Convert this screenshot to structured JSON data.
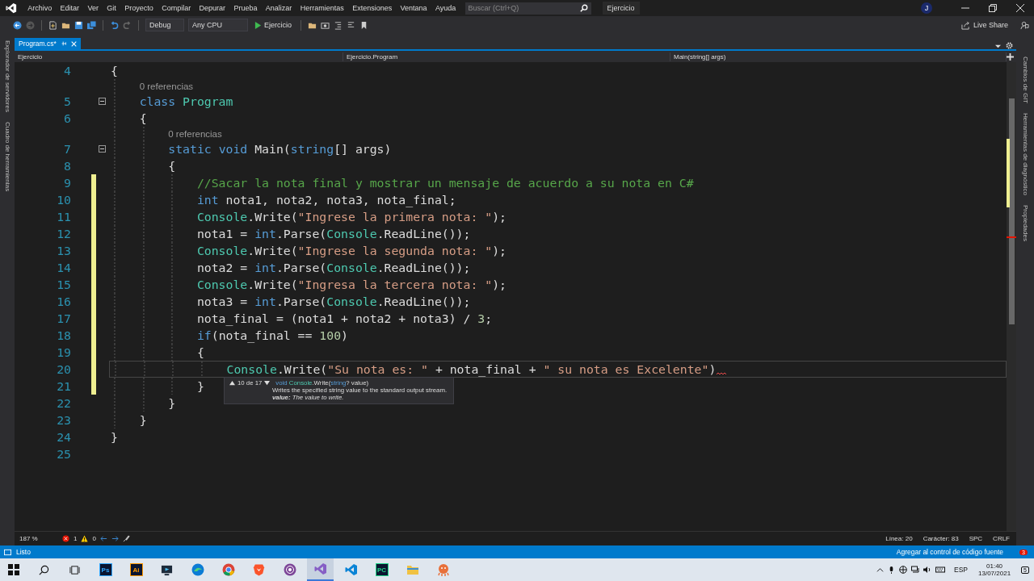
{
  "menu": [
    "Archivo",
    "Editar",
    "Ver",
    "Git",
    "Proyecto",
    "Compilar",
    "Depurar",
    "Prueba",
    "Analizar",
    "Herramientas",
    "Extensiones",
    "Ventana",
    "Ayuda"
  ],
  "search": {
    "placeholder": "Buscar (Ctrl+Q)"
  },
  "solution_name": "Ejercicio",
  "user_initial": "J",
  "toolbar": {
    "configuration": "Debug",
    "platform": "Any CPU",
    "start": "Ejercicio"
  },
  "live_share": "Live Share",
  "left_panels": [
    "Explorador de servidores",
    "Cuadro de herramientas"
  ],
  "right_panels": [
    "Cambios de GIT",
    "Herramientas de diagnóstico",
    "Propiedades"
  ],
  "document_tabs": [
    {
      "label": "Program.cs*",
      "selected": true
    }
  ],
  "nav_bar": {
    "project": "Ejercicio",
    "type": "Ejercicio.Program",
    "member": "Main(string[] args)"
  },
  "editor": {
    "lines": [
      {
        "kind": "code",
        "number": "4",
        "changed": false,
        "fold": false,
        "current": false,
        "error": false,
        "tokens": [
          {
            "kind": "plain",
            "text": "{"
          }
        ]
      },
      {
        "kind": "lens",
        "text": "    0 referencias"
      },
      {
        "kind": "code",
        "number": "5",
        "changed": false,
        "fold": true,
        "current": false,
        "error": false,
        "tokens": [
          {
            "kind": "kw",
            "text": "    class"
          },
          {
            "kind": "type",
            "text": " Program"
          }
        ]
      },
      {
        "kind": "code",
        "number": "6",
        "changed": false,
        "fold": false,
        "current": false,
        "error": false,
        "tokens": [
          {
            "kind": "plain",
            "text": "    {"
          }
        ]
      },
      {
        "kind": "lens",
        "text": "        0 referencias"
      },
      {
        "kind": "code",
        "number": "7",
        "changed": false,
        "fold": true,
        "current": false,
        "error": false,
        "tokens": [
          {
            "kind": "kw",
            "text": "        static"
          },
          {
            "kind": "kw",
            "text": " void"
          },
          {
            "kind": "plain",
            "text": " Main("
          },
          {
            "kind": "kw",
            "text": "string"
          },
          {
            "kind": "plain",
            "text": "[] args)"
          }
        ]
      },
      {
        "kind": "code",
        "number": "8",
        "changed": false,
        "fold": false,
        "current": false,
        "error": false,
        "tokens": [
          {
            "kind": "plain",
            "text": "        {"
          }
        ]
      },
      {
        "kind": "code",
        "number": "9",
        "changed": true,
        "fold": false,
        "current": false,
        "error": false,
        "tokens": [
          {
            "kind": "cmt",
            "text": "            //Sacar la nota final y mostrar un mensaje de acuerdo a su nota en C#"
          }
        ]
      },
      {
        "kind": "code",
        "number": "10",
        "changed": true,
        "fold": false,
        "current": false,
        "error": false,
        "tokens": [
          {
            "kind": "kw",
            "text": "            int"
          },
          {
            "kind": "plain",
            "text": " nota1, nota2, nota3, nota_final;"
          }
        ]
      },
      {
        "kind": "code",
        "number": "11",
        "changed": true,
        "fold": false,
        "current": false,
        "error": false,
        "tokens": [
          {
            "kind": "type",
            "text": "            Console"
          },
          {
            "kind": "plain",
            "text": ".Write("
          },
          {
            "kind": "str",
            "text": "\"Ingrese la primera nota: \""
          },
          {
            "kind": "plain",
            "text": ");"
          }
        ]
      },
      {
        "kind": "code",
        "number": "12",
        "changed": true,
        "fold": false,
        "current": false,
        "error": false,
        "tokens": [
          {
            "kind": "plain",
            "text": "            nota1 = "
          },
          {
            "kind": "kw",
            "text": "int"
          },
          {
            "kind": "plain",
            "text": ".Parse("
          },
          {
            "kind": "type",
            "text": "Console"
          },
          {
            "kind": "plain",
            "text": ".ReadLine());"
          }
        ]
      },
      {
        "kind": "code",
        "number": "13",
        "changed": true,
        "fold": false,
        "current": false,
        "error": false,
        "tokens": [
          {
            "kind": "type",
            "text": "            Console"
          },
          {
            "kind": "plain",
            "text": ".Write("
          },
          {
            "kind": "str",
            "text": "\"Ingrese la segunda nota: \""
          },
          {
            "kind": "plain",
            "text": ");"
          }
        ]
      },
      {
        "kind": "code",
        "number": "14",
        "changed": true,
        "fold": false,
        "current": false,
        "error": false,
        "tokens": [
          {
            "kind": "plain",
            "text": "            nota2 = "
          },
          {
            "kind": "kw",
            "text": "int"
          },
          {
            "kind": "plain",
            "text": ".Parse("
          },
          {
            "kind": "type",
            "text": "Console"
          },
          {
            "kind": "plain",
            "text": ".ReadLine());"
          }
        ]
      },
      {
        "kind": "code",
        "number": "15",
        "changed": true,
        "fold": false,
        "current": false,
        "error": false,
        "tokens": [
          {
            "kind": "type",
            "text": "            Console"
          },
          {
            "kind": "plain",
            "text": ".Write("
          },
          {
            "kind": "str",
            "text": "\"Ingresa la tercera nota: \""
          },
          {
            "kind": "plain",
            "text": ");"
          }
        ]
      },
      {
        "kind": "code",
        "number": "16",
        "changed": true,
        "fold": false,
        "current": false,
        "error": false,
        "tokens": [
          {
            "kind": "plain",
            "text": "            nota3 = "
          },
          {
            "kind": "kw",
            "text": "int"
          },
          {
            "kind": "plain",
            "text": ".Parse("
          },
          {
            "kind": "type",
            "text": "Console"
          },
          {
            "kind": "plain",
            "text": ".ReadLine());"
          }
        ]
      },
      {
        "kind": "code",
        "number": "17",
        "changed": true,
        "fold": false,
        "current": false,
        "error": false,
        "tokens": [
          {
            "kind": "plain",
            "text": "            nota_final = (nota1 + nota2 + nota3) / "
          },
          {
            "kind": "num",
            "text": "3"
          },
          {
            "kind": "plain",
            "text": ";"
          }
        ]
      },
      {
        "kind": "code",
        "number": "18",
        "changed": true,
        "fold": false,
        "current": false,
        "error": false,
        "tokens": [
          {
            "kind": "kw",
            "text": "            if"
          },
          {
            "kind": "plain",
            "text": "(nota_final == "
          },
          {
            "kind": "num",
            "text": "100"
          },
          {
            "kind": "plain",
            "text": ")"
          }
        ]
      },
      {
        "kind": "code",
        "number": "19",
        "changed": true,
        "fold": false,
        "current": false,
        "error": false,
        "tokens": [
          {
            "kind": "plain",
            "text": "            {"
          }
        ]
      },
      {
        "kind": "code",
        "number": "20",
        "changed": true,
        "fold": false,
        "current": true,
        "error": true,
        "tokens": [
          {
            "kind": "type",
            "text": "                Console"
          },
          {
            "kind": "plain",
            "text": ".Write("
          },
          {
            "kind": "str",
            "text": "\"Su nota es: \""
          },
          {
            "kind": "plain",
            "text": " + nota_final + "
          },
          {
            "kind": "str",
            "text": "\" su nota es Excelente\""
          },
          {
            "kind": "plain",
            "text": ")"
          }
        ]
      },
      {
        "kind": "code",
        "number": "21",
        "changed": true,
        "fold": false,
        "current": false,
        "error": false,
        "tokens": [
          {
            "kind": "plain",
            "text": "            }"
          }
        ]
      },
      {
        "kind": "code",
        "number": "22",
        "changed": false,
        "fold": false,
        "current": false,
        "error": false,
        "tokens": [
          {
            "kind": "plain",
            "text": "        }"
          }
        ]
      },
      {
        "kind": "code",
        "number": "23",
        "changed": false,
        "fold": false,
        "current": false,
        "error": false,
        "tokens": [
          {
            "kind": "plain",
            "text": "    }"
          }
        ]
      },
      {
        "kind": "code",
        "number": "24",
        "changed": false,
        "fold": false,
        "current": false,
        "error": false,
        "tokens": [
          {
            "kind": "plain",
            "text": "}"
          }
        ]
      },
      {
        "kind": "code",
        "number": "25",
        "changed": false,
        "fold": false,
        "current": false,
        "error": false
      }
    ]
  },
  "tooltip": {
    "counter": "10 de 17",
    "signature": [
      {
        "kind": "kw",
        "text": "void"
      },
      {
        "kind": "type",
        "text": " Console"
      },
      {
        "kind": "plain",
        "text": ".Write("
      },
      {
        "kind": "kw",
        "text": "string"
      },
      {
        "kind": "plain",
        "text": "? value)"
      }
    ],
    "description": "Writes the specified string value to the standard output stream.",
    "param": "**value:** The value to write."
  },
  "editor_status": {
    "zoom": "187 %",
    "errors": "1",
    "warnings": "0",
    "line": "Línea: 20",
    "column": "Carácter: 83",
    "whitespace": "SPC",
    "line_ending": "CRLF"
  },
  "status_bar": {
    "text": "Listo",
    "source_control": "Agregar al control de código fuente",
    "notifications": "3"
  },
  "taskbar": {
    "apps": [
      {
        "kind": "start",
        "selected": false
      },
      {
        "kind": "search",
        "selected": false
      },
      {
        "kind": "taskview",
        "selected": false
      },
      {
        "kind": "badge",
        "label": "Ps",
        "color": "#31a8ff",
        "selected": false
      },
      {
        "kind": "badge",
        "label": "Ai",
        "color": "#ff9a00",
        "selected": false
      },
      {
        "kind": "monitor",
        "selected": false
      },
      {
        "kind": "wave",
        "selected": false
      },
      {
        "kind": "ring",
        "selected": false
      },
      {
        "kind": "shield",
        "selected": false
      },
      {
        "kind": "orb",
        "selected": false
      },
      {
        "kind": "vs",
        "selected": true
      },
      {
        "kind": "code",
        "selected": false
      },
      {
        "kind": "badge",
        "label": "PC",
        "color": "#21d789",
        "selected": false
      },
      {
        "kind": "folder",
        "selected": false
      },
      {
        "kind": "octopus",
        "selected": false
      }
    ],
    "language": "ESP",
    "time": "01:40",
    "date": "13/07/2021",
    "notifications": "5"
  }
}
